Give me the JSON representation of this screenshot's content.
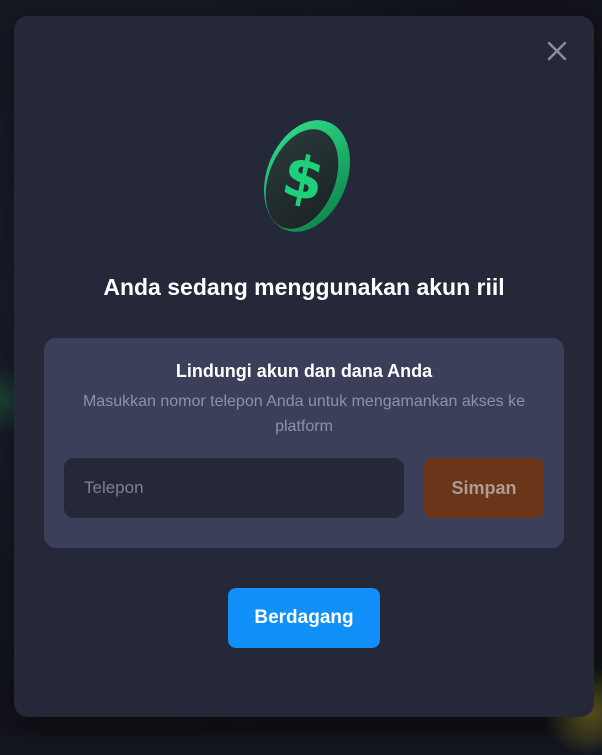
{
  "modal": {
    "close_icon": "close-icon",
    "coin_icon": "dollar-coin-icon",
    "title": "Anda sedang menggunakan akun riil",
    "protect": {
      "title": "Lindungi akun dan dana Anda",
      "description": "Masukkan nomor telepon Anda untuk mengamankan akses ke platform",
      "phone_placeholder": "Telepon",
      "phone_value": "",
      "save_label": "Simpan"
    },
    "trade_label": "Berdagang"
  },
  "colors": {
    "modal_bg": "#252838",
    "card_bg": "#3b3f59",
    "save_button": "#6a3518",
    "trade_button": "#1190fa",
    "coin_green": "#1fd07a"
  }
}
